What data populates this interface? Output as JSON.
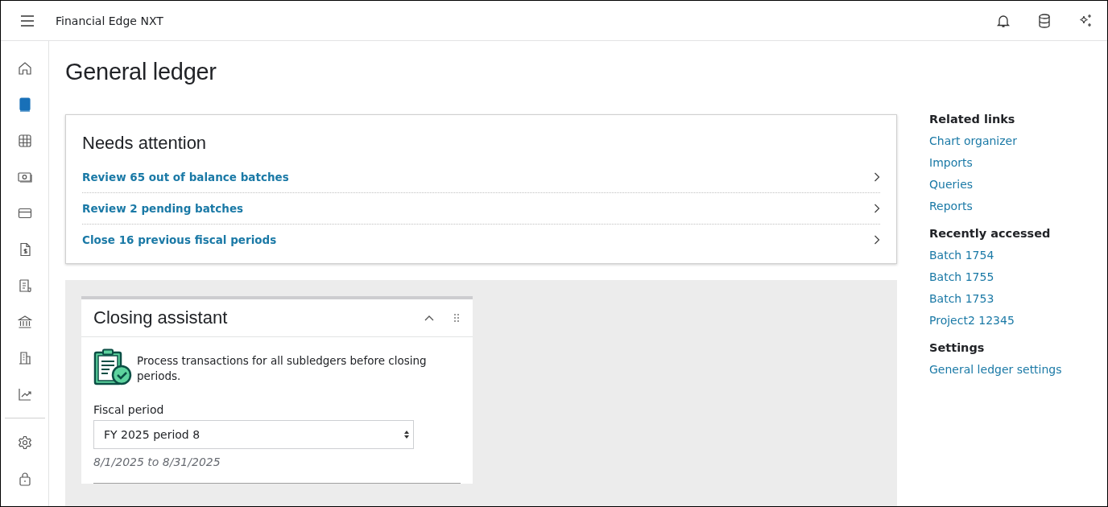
{
  "app": {
    "title": "Financial Edge NXT"
  },
  "sidebar": {
    "items": [
      {
        "selected": false
      },
      {
        "selected": true
      },
      {
        "selected": false
      },
      {
        "selected": false
      },
      {
        "selected": false
      },
      {
        "selected": false
      },
      {
        "selected": false
      },
      {
        "selected": false
      },
      {
        "selected": false
      },
      {
        "selected": false
      }
    ],
    "bottom_items": [
      {
        "selected": false
      },
      {
        "selected": false
      }
    ]
  },
  "page": {
    "title": "General ledger"
  },
  "needs_attention": {
    "title": "Needs attention",
    "items": [
      "Review 65 out of balance batches",
      "Review 2 pending batches",
      "Close 16 previous fiscal periods"
    ]
  },
  "closing_assistant": {
    "title": "Closing assistant",
    "expanded": true,
    "message": "Process transactions for all subledgers before closing periods.",
    "field_label": "Fiscal period",
    "value": "FY 2025 period 8",
    "date_range": "8/1/2025 to 8/31/2025"
  },
  "related": [
    {
      "heading": "Related links",
      "links": [
        "Chart organizer",
        "Imports",
        "Queries",
        "Reports"
      ]
    },
    {
      "heading": "Recently accessed",
      "links": [
        "Batch 1754",
        "Batch 1755",
        "Batch 1753",
        "Project2 12345"
      ]
    },
    {
      "heading": "Settings",
      "links": [
        "General ledger settings"
      ]
    }
  ]
}
